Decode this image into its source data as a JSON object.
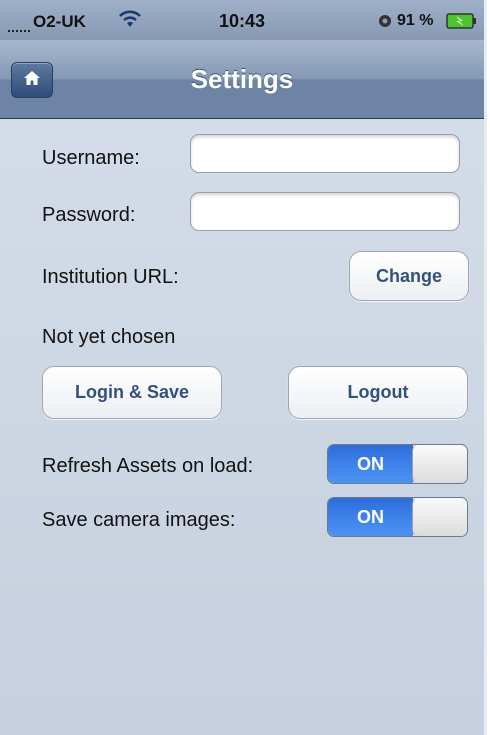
{
  "status_bar": {
    "carrier": "O2-UK",
    "time": "10:43",
    "battery_percent": "91 %"
  },
  "nav": {
    "title": "Settings",
    "home_icon": "home-icon"
  },
  "form": {
    "username_label": "Username:",
    "username_value": "",
    "password_label": "Password:",
    "password_value": "",
    "institution_label": "Institution URL:",
    "change_button": "Change",
    "institution_status": "Not yet chosen",
    "login_button": "Login & Save",
    "logout_button": "Logout",
    "refresh_label": "Refresh Assets on load:",
    "refresh_toggle": "ON",
    "save_images_label": "Save camera images:",
    "save_images_toggle": "ON"
  },
  "colors": {
    "nav_bar": "#7b91b0",
    "background": "#cfd8e5",
    "button_text": "#34507d",
    "toggle_on": "#3c82ea"
  }
}
